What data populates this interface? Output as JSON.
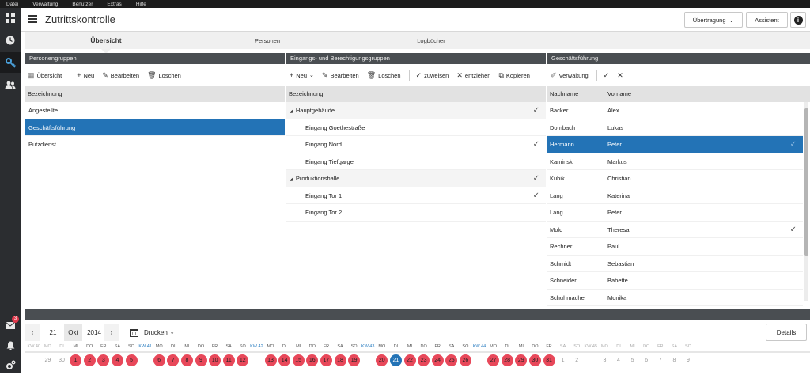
{
  "menubar": [
    "Datei",
    "Verwaltung",
    "Benutzer",
    "Extras",
    "Hilfe"
  ],
  "sidebar": {
    "icons": [
      "dashboard-icon",
      "clock-icon",
      "key-icon",
      "users-icon",
      "mail-icon",
      "bell-icon",
      "settings-icon"
    ],
    "mail_badge": "3"
  },
  "header": {
    "title": "Zutrittskontrolle",
    "uebertragung": "Übertragung",
    "assistent": "Assistent",
    "info": "i"
  },
  "tabs": [
    {
      "label": "Übersicht"
    },
    {
      "label": "Personen"
    },
    {
      "label": "Logbücher"
    }
  ],
  "panel1": {
    "title": "Personengruppen",
    "toolbar": {
      "uebersicht": "Übersicht",
      "neu": "Neu",
      "bearbeiten": "Bearbeiten",
      "loeschen": "Löschen"
    },
    "column": "Bezeichnung",
    "rows": [
      {
        "label": "Angestellte"
      },
      {
        "label": "Geschäftsführung"
      },
      {
        "label": "Putzdienst"
      }
    ]
  },
  "panel2": {
    "title": "Eingangs- und Berechtigungsgruppen",
    "toolbar": {
      "neu": "Neu",
      "bearbeiten": "Bearbeiten",
      "loeschen": "Löschen",
      "zuweisen": "zuweisen",
      "entziehen": "entziehen",
      "kopieren": "Kopieren"
    },
    "column": "Bezeichnung",
    "rows": [
      {
        "label": "Hauptgebäude",
        "group": true,
        "checked": true
      },
      {
        "label": "Eingang Goethestraße",
        "group": false,
        "checked": false
      },
      {
        "label": "Eingang Nord",
        "group": false,
        "checked": true
      },
      {
        "label": "Eingang Tiefgarge",
        "group": false,
        "checked": false
      },
      {
        "label": "Produktionshalle",
        "group": true,
        "checked": true
      },
      {
        "label": "Eingang Tor 1",
        "group": false,
        "checked": true
      },
      {
        "label": "Eingang Tor 2",
        "group": false,
        "checked": false
      }
    ]
  },
  "panel3": {
    "title": "Geschäftsführung",
    "toolbar": {
      "verwaltung": "Verwaltung"
    },
    "columns": {
      "nachname": "Nachname",
      "vorname": "Vorname"
    },
    "rows": [
      {
        "nachname": "Backer",
        "vorname": "Alex",
        "checked": false
      },
      {
        "nachname": "Dombach",
        "vorname": "Lukas",
        "checked": false
      },
      {
        "nachname": "Hermann",
        "vorname": "Peter",
        "checked": true
      },
      {
        "nachname": "Kaminski",
        "vorname": "Markus",
        "checked": false
      },
      {
        "nachname": "Kubik",
        "vorname": "Christian",
        "checked": false
      },
      {
        "nachname": "Lang",
        "vorname": "Katerina",
        "checked": false
      },
      {
        "nachname": "Lang",
        "vorname": "Peter",
        "checked": false
      },
      {
        "nachname": "Mold",
        "vorname": "Theresa",
        "checked": true
      },
      {
        "nachname": "Rechner",
        "vorname": "Paul",
        "checked": false
      },
      {
        "nachname": "Schmidt",
        "vorname": "Sebastian",
        "checked": false
      },
      {
        "nachname": "Schneider",
        "vorname": "Babette",
        "checked": false
      },
      {
        "nachname": "Schuhmacher",
        "vorname": "Monika",
        "checked": false
      }
    ]
  },
  "calendar": {
    "prev": "‹",
    "next": "›",
    "day": "21",
    "month": "Okt",
    "year": "2014",
    "drucken": "Drucken",
    "details": "Details",
    "heads": [
      "KW 40",
      "MO",
      "DI",
      "MI",
      "DO",
      "FR",
      "SA",
      "SO",
      "KW 41",
      "MO",
      "DI",
      "MI",
      "DO",
      "FR",
      "SA",
      "SO",
      "KW 42",
      "MO",
      "DI",
      "MI",
      "DO",
      "FR",
      "SA",
      "SO",
      "KW 43",
      "MO",
      "DI",
      "MI",
      "DO",
      "FR",
      "SA",
      "SO",
      "KW 44",
      "MO",
      "DI",
      "MI",
      "DO",
      "FR",
      "SA",
      "SO",
      "KW 45",
      "MO",
      "DI",
      "MI",
      "DO",
      "FR",
      "SA",
      "SO"
    ],
    "days": [
      {
        "d": "29",
        "s": "muted"
      },
      {
        "d": "30",
        "s": "muted"
      },
      {
        "d": "1",
        "s": "red"
      },
      {
        "d": "2",
        "s": "red"
      },
      {
        "d": "3",
        "s": "red"
      },
      {
        "d": "4",
        "s": "red"
      },
      {
        "d": "5",
        "s": "red"
      },
      {
        "d": "6",
        "s": "red"
      },
      {
        "d": "7",
        "s": "red"
      },
      {
        "d": "8",
        "s": "red"
      },
      {
        "d": "9",
        "s": "red"
      },
      {
        "d": "10",
        "s": "red"
      },
      {
        "d": "11",
        "s": "red"
      },
      {
        "d": "12",
        "s": "red"
      },
      {
        "d": "13",
        "s": "red"
      },
      {
        "d": "14",
        "s": "red"
      },
      {
        "d": "15",
        "s": "red"
      },
      {
        "d": "16",
        "s": "red"
      },
      {
        "d": "17",
        "s": "red"
      },
      {
        "d": "18",
        "s": "red"
      },
      {
        "d": "19",
        "s": "red"
      },
      {
        "d": "20",
        "s": "red"
      },
      {
        "d": "21",
        "s": "blue"
      },
      {
        "d": "22",
        "s": "red"
      },
      {
        "d": "23",
        "s": "red"
      },
      {
        "d": "24",
        "s": "red"
      },
      {
        "d": "25",
        "s": "red"
      },
      {
        "d": "26",
        "s": "red"
      },
      {
        "d": "27",
        "s": "red"
      },
      {
        "d": "28",
        "s": "red"
      },
      {
        "d": "29",
        "s": "red"
      },
      {
        "d": "30",
        "s": "red"
      },
      {
        "d": "31",
        "s": "red"
      },
      {
        "d": "1",
        "s": "gray"
      },
      {
        "d": "2",
        "s": "gray"
      },
      {
        "d": "3",
        "s": "gray"
      },
      {
        "d": "4",
        "s": "gray"
      },
      {
        "d": "5",
        "s": "gray"
      },
      {
        "d": "6",
        "s": "gray"
      },
      {
        "d": "7",
        "s": "gray"
      },
      {
        "d": "8",
        "s": "gray"
      },
      {
        "d": "9",
        "s": "gray"
      }
    ]
  }
}
